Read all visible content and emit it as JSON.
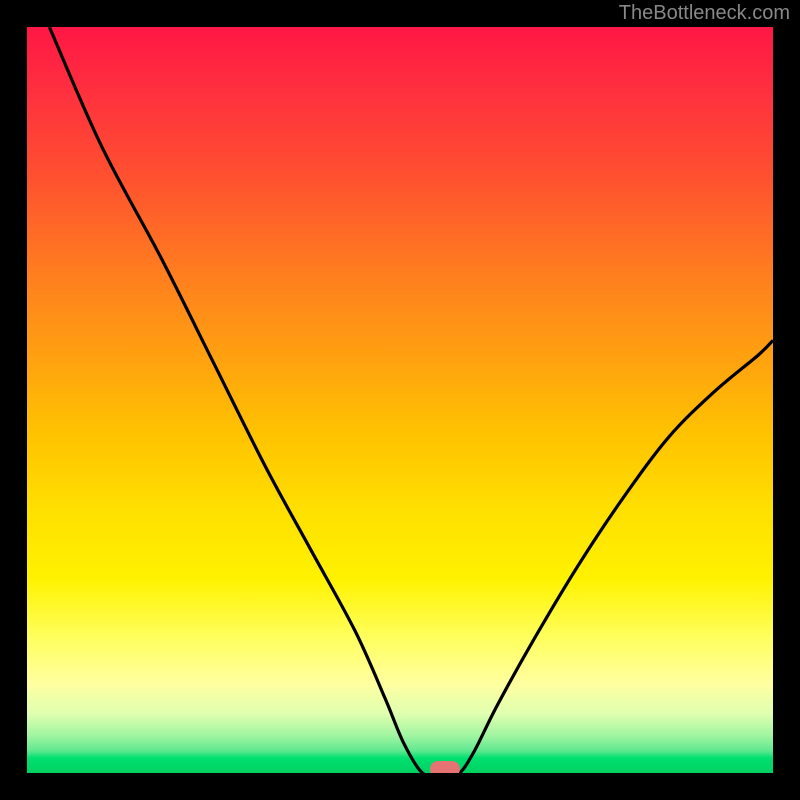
{
  "watermark": "TheBottleneck.com",
  "colors": {
    "gradient_top": "#ff1744",
    "gradient_bottom": "#00d060",
    "curve_stroke": "#000000",
    "marker_fill": "#e57373"
  },
  "chart_data": {
    "type": "line",
    "title": "",
    "xlabel": "",
    "ylabel": "",
    "xlim": [
      0,
      100
    ],
    "ylim": [
      0,
      100
    ],
    "x": [
      3,
      10,
      18,
      25,
      32,
      38,
      44,
      48,
      50.5,
      53,
      55,
      56.5,
      58,
      60,
      63,
      68,
      74,
      80,
      86,
      92,
      98,
      100
    ],
    "y": [
      100,
      84,
      69,
      55,
      41,
      30,
      19,
      10,
      4,
      0,
      0,
      0,
      0,
      3,
      9,
      18,
      28,
      37,
      45,
      51,
      56,
      58
    ],
    "marker": {
      "x": 56,
      "y": 0
    },
    "annotations": []
  }
}
